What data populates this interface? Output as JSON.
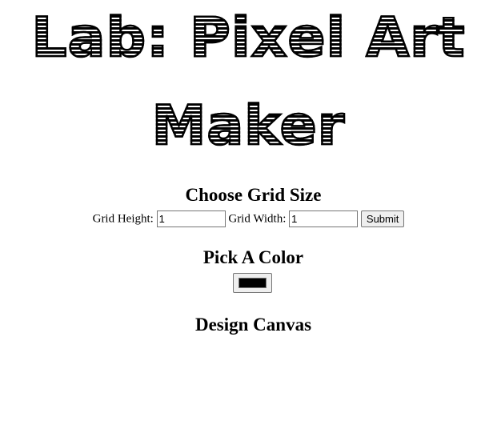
{
  "header": {
    "title_line1": "Lab: Pixel Art",
    "title_line2": "Maker"
  },
  "grid_size": {
    "heading": "Choose Grid Size",
    "height_label": "Grid Height:",
    "height_value": "1",
    "width_label": "Grid Width:",
    "width_value": "1",
    "submit_label": "Submit"
  },
  "color": {
    "heading": "Pick A Color",
    "value": "#000000"
  },
  "canvas": {
    "heading": "Design Canvas"
  }
}
